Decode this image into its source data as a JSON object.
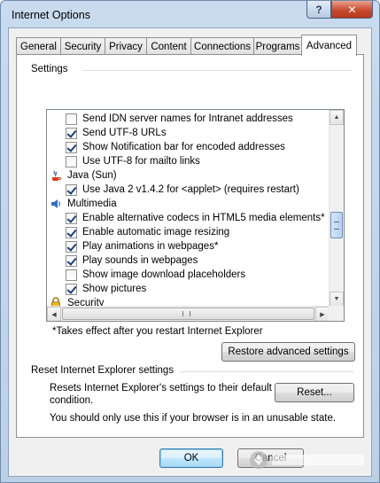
{
  "window": {
    "title": "Internet Options",
    "help_symbol": "?",
    "close_symbol": "✕"
  },
  "tabs": [
    {
      "label": "General",
      "active": false
    },
    {
      "label": "Security",
      "active": false
    },
    {
      "label": "Privacy",
      "active": false
    },
    {
      "label": "Content",
      "active": false
    },
    {
      "label": "Connections",
      "active": false
    },
    {
      "label": "Programs",
      "active": false
    },
    {
      "label": "Advanced",
      "active": true
    }
  ],
  "settings": {
    "group_label": "Settings",
    "items": [
      {
        "kind": "checkbox",
        "checked": false,
        "label": "Send IDN server names for Intranet addresses"
      },
      {
        "kind": "checkbox",
        "checked": true,
        "label": "Send UTF-8 URLs"
      },
      {
        "kind": "checkbox",
        "checked": true,
        "label": "Show Notification bar for encoded addresses"
      },
      {
        "kind": "checkbox",
        "checked": false,
        "label": "Use UTF-8 for mailto links"
      },
      {
        "kind": "category",
        "icon": "java-icon",
        "label": "Java (Sun)"
      },
      {
        "kind": "checkbox",
        "checked": true,
        "label": "Use Java 2 v1.4.2 for <applet> (requires restart)"
      },
      {
        "kind": "category",
        "icon": "multimedia-icon",
        "label": "Multimedia"
      },
      {
        "kind": "checkbox",
        "checked": true,
        "label": "Enable alternative codecs in HTML5 media elements*"
      },
      {
        "kind": "checkbox",
        "checked": true,
        "label": "Enable automatic image resizing"
      },
      {
        "kind": "checkbox",
        "checked": true,
        "label": "Play animations in webpages*"
      },
      {
        "kind": "checkbox",
        "checked": true,
        "label": "Play sounds in webpages"
      },
      {
        "kind": "checkbox",
        "checked": false,
        "label": "Show image download placeholders"
      },
      {
        "kind": "checkbox",
        "checked": true,
        "label": "Show pictures"
      },
      {
        "kind": "category",
        "icon": "lock-icon",
        "label": "Security"
      }
    ],
    "footnote": "*Takes effect after you restart Internet Explorer",
    "restore_button": "Restore advanced settings"
  },
  "reset": {
    "group_label": "Reset Internet Explorer settings",
    "description": "Resets Internet Explorer's settings to their default",
    "description_line2": "condition.",
    "button": "Reset...",
    "warning": "You should only use this if your browser is in an unusable state."
  },
  "footer": {
    "ok_label": "OK",
    "cancel_label": "Cancel"
  },
  "colors": {
    "title_bar": "#c9dbee",
    "close_button": "#c74b2f",
    "default_button_border": "#3c7fb1",
    "check_mark": "#1c3f7a"
  }
}
